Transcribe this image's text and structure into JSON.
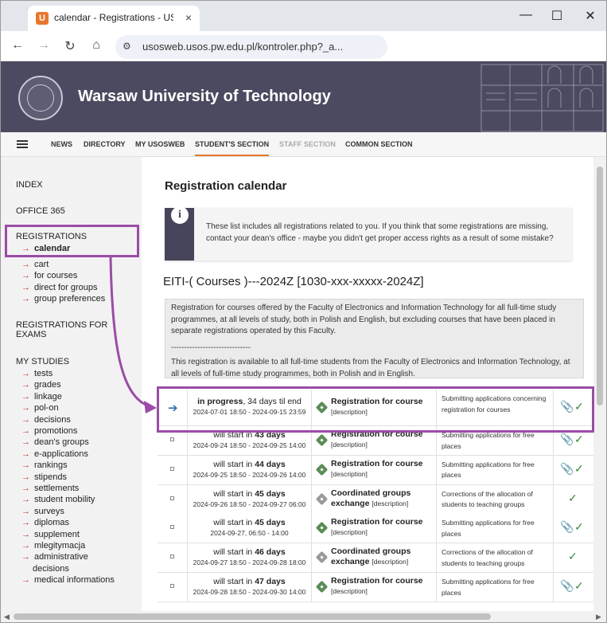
{
  "browser": {
    "tab_title": "calendar - Registrations - USOS",
    "tab_close": "×",
    "favicon_letter": "U",
    "url": "usosweb.usos.pw.edu.pl/kontroler.php?_a...",
    "minimize": "—",
    "maximize": "☐",
    "close": "✕",
    "back": "←",
    "forward": "→",
    "reload": "↻",
    "home": "⌂"
  },
  "header": {
    "site_title": "Warsaw University of Technology"
  },
  "menu": {
    "news": "NEWS",
    "directory": "DIRECTORY",
    "my_usosweb": "MY USOSWEB",
    "student_section": "STUDENT'S SECTION",
    "staff_section": "STAFF SECTION",
    "common_section": "COMMON SECTION"
  },
  "sidebar": {
    "index": "INDEX",
    "office365": "OFFICE 365",
    "registrations": "REGISTRATIONS",
    "reg_items": [
      "calendar",
      "cart",
      "for courses",
      "direct for groups",
      "group preferences"
    ],
    "reg_exams_1": "REGISTRATIONS FOR",
    "reg_exams_2": "EXAMS",
    "my_studies": "MY STUDIES",
    "study_items": [
      "tests",
      "grades",
      "linkage",
      "pol-on",
      "decisions",
      "promotions",
      "dean's groups",
      "e-applications",
      "rankings",
      "stipends",
      "settlements",
      "student mobility",
      "surveys",
      "diplomas",
      "supplement",
      "mlegitymacja",
      "administrative",
      "medical informations"
    ],
    "study_items_cont": "decisions"
  },
  "main": {
    "page_title": "Registration calendar",
    "info_text": "These list includes all registrations related to you. If you think that some registrations are missing, contact your dean's office - maybe you didn't get proper access rights as a result of some mistake?",
    "registration_title": "EITI-( Courses )---2024Z [1030-xxx-xxxxx-2024Z]",
    "desc_p1": "Registration for courses offered by the Faculty of Electronics and Information Technology for all full-time study programmes, at all levels of study, both in Polish and English, but excluding courses that have been placed in separate registrations operated by this Faculty.",
    "desc_sep": "------------------------------",
    "desc_p2": "This registration is available to all full-time students from the Faculty of Electronics and Information Technology, at all levels of full-time study programmes, both in Polish and in English."
  },
  "rows": [
    {
      "state_bold": "in progress",
      "state_rest": ", 34 days til end",
      "dates": "2024-07-01 18:50 - 2024-09-15 23:59",
      "type": "Registration for course",
      "descr": "[description]",
      "desc": "Submitting applications concerning registration for courses",
      "icon": "green",
      "current": true,
      "clip": true
    },
    {
      "state_pre": "will start in ",
      "state_bold": "43 days",
      "dates": "2024-09-24 18:50 - 2024-09-25 14:00",
      "type": "Registration for course",
      "descr": "[description]",
      "desc": "Submitting applications for free places",
      "icon": "green",
      "clip": true
    },
    {
      "state_pre": "will start in ",
      "state_bold": "44 days",
      "dates": "2024-09-25 18:50 - 2024-09-26 14:00",
      "type": "Registration for course",
      "descr": "[description]",
      "desc": "Submitting applications for free places",
      "icon": "green",
      "clip": true
    },
    {
      "state_pre": "will start in ",
      "state_bold": "45 days",
      "dates": "2024-09-26 18:50 - 2024-09-27 06:00",
      "type": "Coordinated groups exchange",
      "descr": "[description]",
      "desc": "Corrections of the allocation of students to teaching groups",
      "icon": "grey",
      "clip": false
    },
    {
      "state_pre": "will start in ",
      "state_bold": "45 days",
      "dates": "2024-09-27, 06:50 - 14:00",
      "type": "Registration for course",
      "descr": "[description]",
      "desc": "Submitting applications for free places",
      "icon": "green",
      "clip": true
    },
    {
      "state_pre": "will start in ",
      "state_bold": "46 days",
      "dates": "2024-09-27 18:50 - 2024-09-28 18:00",
      "type": "Coordinated groups exchange",
      "descr": "[description]",
      "desc": "Corrections of the allocation of students to teaching groups",
      "icon": "grey",
      "clip": false
    },
    {
      "state_pre": "will start in ",
      "state_bold": "47 days",
      "dates": "2024-09-28 18:50 - 2024-09-30 14:00",
      "type": "Registration for course",
      "descr": "[description]",
      "desc": "Submitting applications for free places",
      "icon": "green",
      "clip": true
    }
  ],
  "icons": {
    "paperclip": "paperclip-icon",
    "check": "check-icon",
    "current": "arrow-right-icon"
  },
  "colors": {
    "header_bg": "#4b4a60",
    "accent": "#e8772e",
    "annotation": "#9b4ca7",
    "sidebar_arrow": "#c0392b"
  }
}
